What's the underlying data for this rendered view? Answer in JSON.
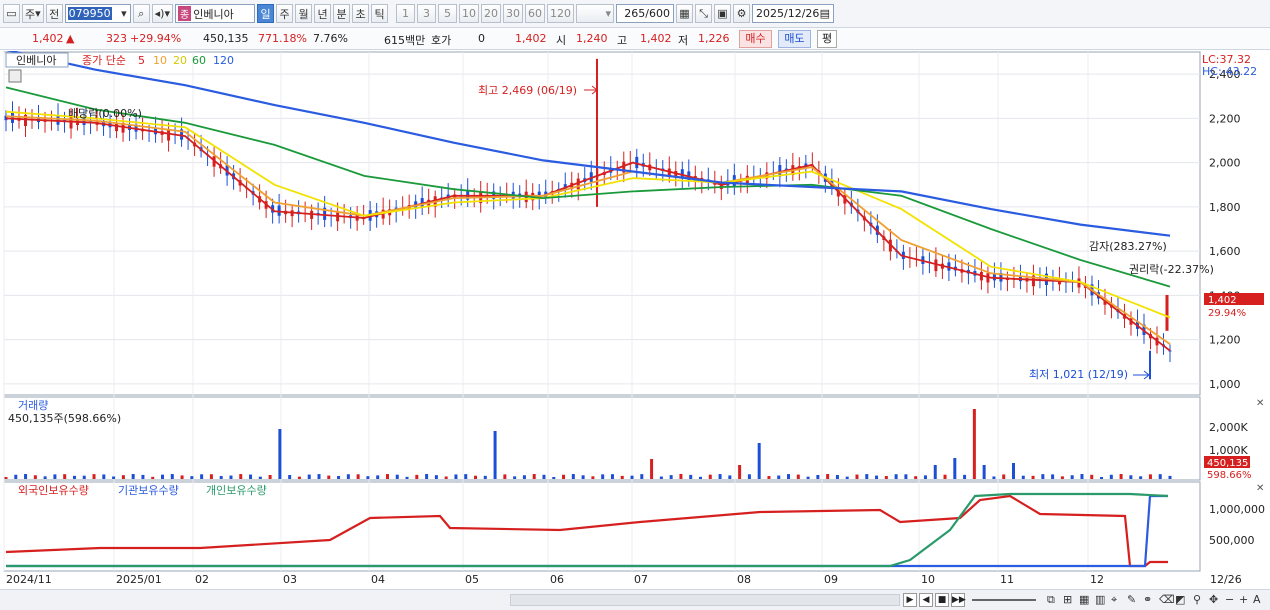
{
  "toolbar": {
    "interval_label": "주",
    "prev_label": "전",
    "code": "079950",
    "name": "인베니아",
    "jong_tag": "종",
    "periods": [
      "일",
      "주",
      "월",
      "년",
      "분",
      "초",
      "틱"
    ],
    "period_active": "일",
    "minute_steps": [
      "1",
      "3",
      "5",
      "10",
      "20",
      "30",
      "60",
      "120"
    ],
    "count": "265",
    "count_total": "/600",
    "date": "2025/12/26"
  },
  "quote": {
    "price": "1,402",
    "change": "323",
    "change_pct": "+29.94%",
    "volume": "450,135",
    "volume_ratio": "771.18%",
    "turnover": "7.76%",
    "amount": "615백만",
    "hoga_label": "호가",
    "hoga_value": "0",
    "hoga_price": "1,402",
    "open_label": "시",
    "open": "1,240",
    "high_label": "고",
    "high": "1,402",
    "low_label": "저",
    "low": "1,226",
    "buy_label": "매수",
    "sell_label": "매도",
    "pyeong_label": "평"
  },
  "price_panel": {
    "stock_label": "인베니아",
    "ma_title": "종가 단순",
    "ma_periods": [
      "5",
      "10",
      "20",
      "60",
      "120"
    ],
    "lc": "LC:37.32",
    "hc": "HC:-43.22",
    "high_annotation": "최고 2,469 (06/19)",
    "low_annotation": "최저 1,021 (12/19)",
    "dividend_annotation": "배당락(0.00%)",
    "reduction_annotation": "감자(283.27%)",
    "rights_annotation": "권리락(-22.37%)",
    "current_tag": "1,402",
    "current_pct": "29.94%",
    "y_ticks": [
      "2,400",
      "2,200",
      "2,000",
      "1,800",
      "1,600",
      "1,400",
      "1,200",
      "1,000"
    ]
  },
  "volume_panel": {
    "title": "거래량",
    "value": "450,135주(598.66%)",
    "y_ticks": [
      "2,000K",
      "1,000K"
    ],
    "current_tag": "450,135",
    "current_pct": "598.66%"
  },
  "holdings_panel": {
    "series_foreign": "외국인보유수량",
    "series_institution": "기관보유수량",
    "series_individual": "개인보유수량",
    "y_ticks": [
      "1,000,000",
      "500,000"
    ]
  },
  "x_axis": {
    "labels": [
      "2024/11",
      "2025/01",
      "02",
      "03",
      "04",
      "05",
      "06",
      "07",
      "08",
      "09",
      "10",
      "11",
      "12"
    ],
    "last_date": "12/26"
  },
  "colors": {
    "up": "#d62020",
    "down": "#1d4fd6",
    "ma5": "#d62020",
    "ma10": "#f0a030",
    "ma20": "#f2e200",
    "ma60": "#1a9a3a",
    "ma120": "#2a5be0",
    "foreign": "#d62020",
    "institution": "#2a5be0",
    "individual": "#2a9a6a"
  },
  "chart_data": {
    "type": "line",
    "x": [
      "2024/11",
      "2025/01",
      "02",
      "03",
      "04",
      "05",
      "06",
      "07",
      "08",
      "09",
      "10",
      "11",
      "12",
      "12/26"
    ],
    "series": [
      {
        "name": "5",
        "values": [
          2200,
          2180,
          2120,
          1780,
          1750,
          1850,
          1850,
          2000,
          1900,
          1990,
          1580,
          1480,
          1460,
          1150
        ]
      },
      {
        "name": "10",
        "values": [
          2210,
          2190,
          2140,
          1820,
          1760,
          1840,
          1850,
          1960,
          1910,
          1980,
          1650,
          1500,
          1460,
          1180
        ]
      },
      {
        "name": "20",
        "values": [
          2230,
          2200,
          2160,
          1900,
          1760,
          1820,
          1840,
          1930,
          1910,
          1960,
          1790,
          1530,
          1460,
          1300
        ]
      },
      {
        "name": "60",
        "values": [
          2340,
          2240,
          2180,
          2080,
          1940,
          1880,
          1840,
          1870,
          1890,
          1900,
          1850,
          1700,
          1560,
          1440
        ]
      },
      {
        "name": "120",
        "values": [
          2510,
          2420,
          2350,
          2260,
          2180,
          2090,
          2010,
          1960,
          1910,
          1890,
          1870,
          1790,
          1720,
          1670
        ]
      }
    ],
    "ylim": [
      950,
      2500
    ],
    "high": {
      "value": 2469,
      "date": "06/19"
    },
    "low": {
      "value": 1021,
      "date": "12/19"
    }
  }
}
